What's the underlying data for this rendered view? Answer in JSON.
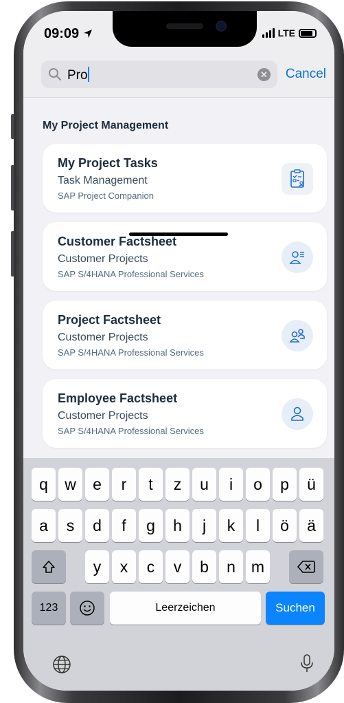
{
  "status_bar": {
    "time": "09:09",
    "network": "LTE"
  },
  "search": {
    "query": "Pro",
    "cancel_label": "Cancel"
  },
  "section_title": "My Project Management",
  "apps": [
    {
      "title": "My Project Tasks",
      "subtitle": "Task Management",
      "description": "SAP Project Companion",
      "icon": "task-clipboard-icon"
    },
    {
      "title": "Customer Factsheet",
      "subtitle": "Customer Projects",
      "description": "SAP S/4HANA Professional Services",
      "icon": "customer-icon"
    },
    {
      "title": "Project Factsheet",
      "subtitle": "Customer Projects",
      "description": "SAP S/4HANA Professional Services",
      "icon": "project-team-icon"
    },
    {
      "title": "Employee Factsheet",
      "subtitle": "Customer Projects",
      "description": "SAP S/4HANA Professional Services",
      "icon": "employee-icon"
    }
  ],
  "keyboard": {
    "row1": [
      "q",
      "w",
      "e",
      "r",
      "t",
      "z",
      "u",
      "i",
      "o",
      "p",
      "ü"
    ],
    "row2": [
      "a",
      "s",
      "d",
      "f",
      "g",
      "h",
      "j",
      "k",
      "l",
      "ö",
      "ä"
    ],
    "row3": [
      "y",
      "x",
      "c",
      "v",
      "b",
      "n",
      "m"
    ],
    "numbers_label": "123",
    "space_label": "Leerzeichen",
    "search_label": "Suchen"
  },
  "colors": {
    "accent": "#0a84ff",
    "cancel": "#0a72d6",
    "card_title": "#1d2d3e"
  }
}
